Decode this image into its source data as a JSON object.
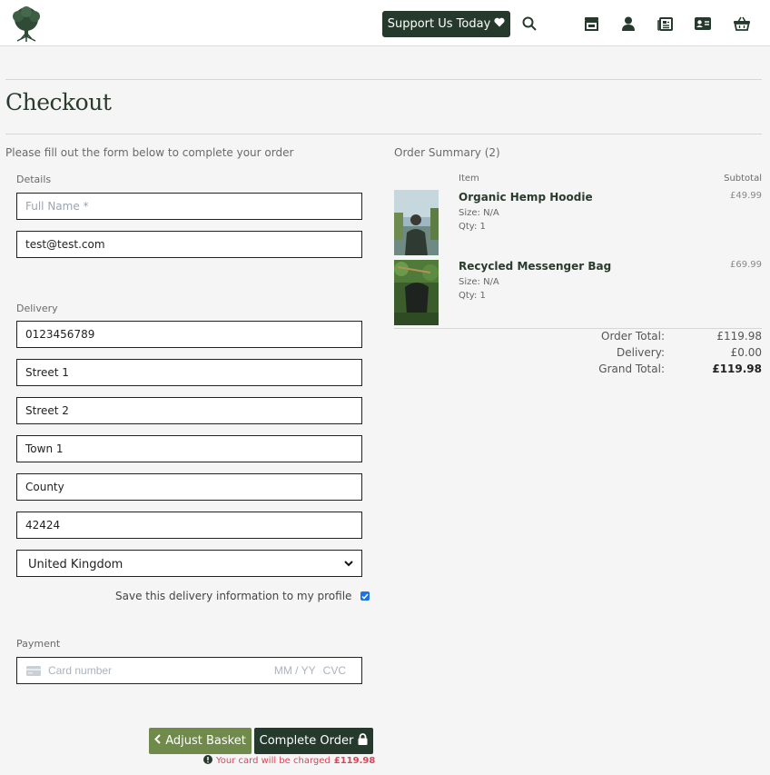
{
  "header": {
    "support_label": "Support Us Today",
    "icons": [
      "search-icon",
      "store-icon",
      "user-icon",
      "newspaper-icon",
      "contact-card-icon",
      "basket-icon"
    ],
    "brand_color": "#253a2c"
  },
  "page": {
    "title": "Checkout",
    "form_intro": "Please fill out the form below to complete your order"
  },
  "details": {
    "label": "Details",
    "full_name_placeholder": "Full Name *",
    "email_value": "test@test.com"
  },
  "delivery": {
    "label": "Delivery",
    "phone": "0123456789",
    "street1": "Street 1",
    "street2": "Street 2",
    "town": "Town 1",
    "county": "County",
    "postcode": "42424",
    "country": "United Kingdom",
    "save_label": "Save this delivery information to my profile",
    "save_checked": true
  },
  "payment": {
    "label": "Payment",
    "card_placeholder": "Card number",
    "expiry_placeholder": "MM / YY",
    "cvc_placeholder": "CVC"
  },
  "actions": {
    "adjust_label": "Adjust Basket",
    "complete_label": "Complete Order",
    "charge_text": "Your card will be charged",
    "charge_amount": "£119.98"
  },
  "summary": {
    "title": "Order Summary (2)",
    "col_item": "Item",
    "col_subtotal": "Subtotal",
    "items": [
      {
        "name": "Organic Hemp Hoodie",
        "size": "Size: N/A",
        "qty": "Qty: 1",
        "price": "£49.99"
      },
      {
        "name": "Recycled Messenger Bag",
        "size": "Size: N/A",
        "qty": "Qty: 1",
        "price": "£69.99"
      }
    ],
    "order_total_label": "Order Total:",
    "order_total": "£119.98",
    "delivery_label": "Delivery:",
    "delivery_value": "£0.00",
    "grand_total_label": "Grand Total:",
    "grand_total": "£119.98"
  }
}
